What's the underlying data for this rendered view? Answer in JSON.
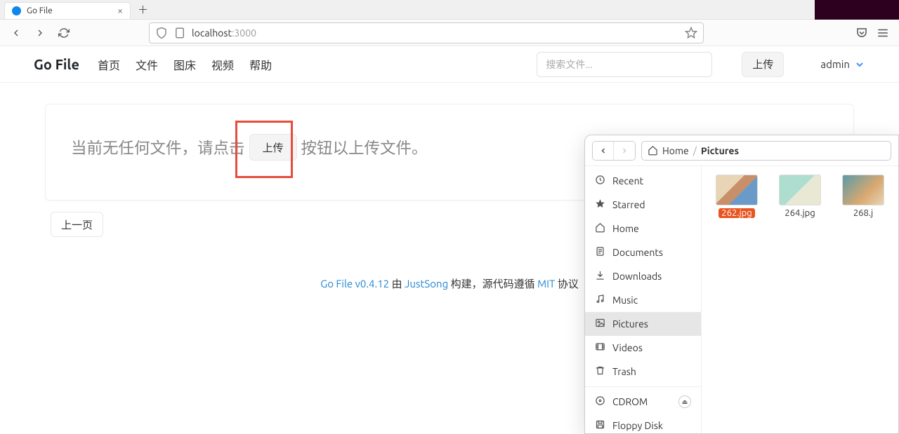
{
  "browser": {
    "tab_title": "Go File",
    "window_controls": {
      "min": "–",
      "max": "▢",
      "close": "×"
    },
    "url_host": "localhost",
    "url_path": ":3000"
  },
  "nav": {
    "brand": "Go File",
    "links": [
      "首页",
      "文件",
      "图床",
      "视频",
      "帮助"
    ],
    "search_placeholder": "搜索文件...",
    "upload": "上传",
    "user": "admin"
  },
  "content": {
    "empty_before": "当前无任何文件，请点击",
    "inline_upload": "上传",
    "empty_after": "按钮以上传文件。",
    "prev_page": "上一页"
  },
  "footer": {
    "app_link": "Go File v0.4.12",
    "by": " 由 ",
    "author_link": "JustSong",
    "built": " 构建，源代码遵循 ",
    "license_link": "MIT",
    "agreement": " 协议"
  },
  "dialog": {
    "path_home": "Home",
    "path_current": "Pictures",
    "sidebar": [
      {
        "icon": "recent",
        "label": "Recent"
      },
      {
        "icon": "star",
        "label": "Starred"
      },
      {
        "icon": "home",
        "label": "Home"
      },
      {
        "icon": "doc",
        "label": "Documents"
      },
      {
        "icon": "download",
        "label": "Downloads"
      },
      {
        "icon": "music",
        "label": "Music"
      },
      {
        "icon": "picture",
        "label": "Pictures",
        "active": true
      },
      {
        "icon": "video",
        "label": "Videos"
      },
      {
        "icon": "trash",
        "label": "Trash"
      },
      {
        "divider": true
      },
      {
        "icon": "cd",
        "label": "CDROM",
        "eject": true
      },
      {
        "icon": "floppy",
        "label": "Floppy Disk"
      }
    ],
    "files": [
      {
        "name": "262.jpg",
        "selected": true,
        "thumb": "t1"
      },
      {
        "name": "264.jpg",
        "thumb": "t2"
      },
      {
        "name": "268.j",
        "thumb": "t3"
      }
    ]
  }
}
